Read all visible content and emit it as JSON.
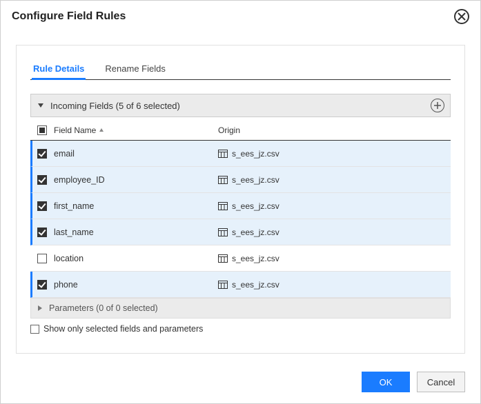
{
  "title": "Configure Field Rules",
  "tabs": {
    "details": "Rule Details",
    "rename": "Rename Fields"
  },
  "group": {
    "incoming_label": "Incoming Fields (5 of 6 selected)",
    "parameters_label": "Parameters (0 of 0 selected)"
  },
  "columns": {
    "fieldname": "Field Name",
    "origin": "Origin"
  },
  "fields": [
    {
      "name": "email",
      "origin": "s_ees_jz.csv",
      "checked": true
    },
    {
      "name": "employee_ID",
      "origin": "s_ees_jz.csv",
      "checked": true
    },
    {
      "name": "first_name",
      "origin": "s_ees_jz.csv",
      "checked": true
    },
    {
      "name": "last_name",
      "origin": "s_ees_jz.csv",
      "checked": true
    },
    {
      "name": "location",
      "origin": "s_ees_jz.csv",
      "checked": false
    },
    {
      "name": "phone",
      "origin": "s_ees_jz.csv",
      "checked": true
    }
  ],
  "show_only_label": "Show only selected fields and parameters",
  "buttons": {
    "ok": "OK",
    "cancel": "Cancel"
  }
}
